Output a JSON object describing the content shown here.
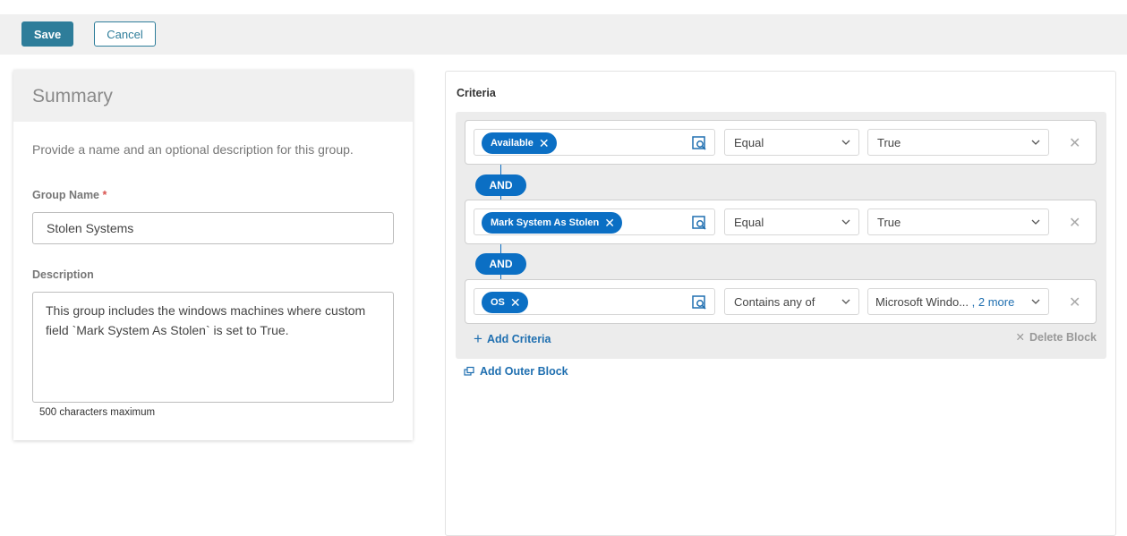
{
  "toolbar": {
    "save_label": "Save",
    "cancel_label": "Cancel"
  },
  "summary": {
    "title": "Summary",
    "description": "Provide a name and an optional description for this group.",
    "group_name_label": "Group Name",
    "required_mark": "*",
    "group_name_value": "Stolen Systems",
    "description_label": "Description",
    "description_value": "This  group includes the windows machines where custom field `Mark System As Stolen` is set to True.",
    "char_hint": "500 characters maximum"
  },
  "criteria": {
    "title": "Criteria",
    "rows": [
      {
        "field": "Available",
        "operator": "Equal",
        "value": "True",
        "more": ""
      },
      {
        "field": "Mark System As Stolen",
        "operator": "Equal",
        "value": "True",
        "more": ""
      },
      {
        "field": "OS",
        "operator": "Contains any of",
        "value": "Microsoft Windo...",
        "more": ", 2 more"
      }
    ],
    "joiners": [
      "AND",
      "AND"
    ],
    "add_criteria_label": "Add Criteria",
    "delete_block_label": "Delete Block",
    "add_outer_block_label": "Add Outer Block"
  },
  "icons": {
    "chip_remove": "x-icon",
    "lookup": "search-list-icon",
    "chevron": "chevron-down-icon",
    "row_remove": "close-icon",
    "add": "plus-icon",
    "outer_block": "copy-block-icon"
  },
  "colors": {
    "primary": "#2e7d9a",
    "chip": "#0b6fc4",
    "link": "#1f6fb0",
    "required": "#d9534f"
  }
}
